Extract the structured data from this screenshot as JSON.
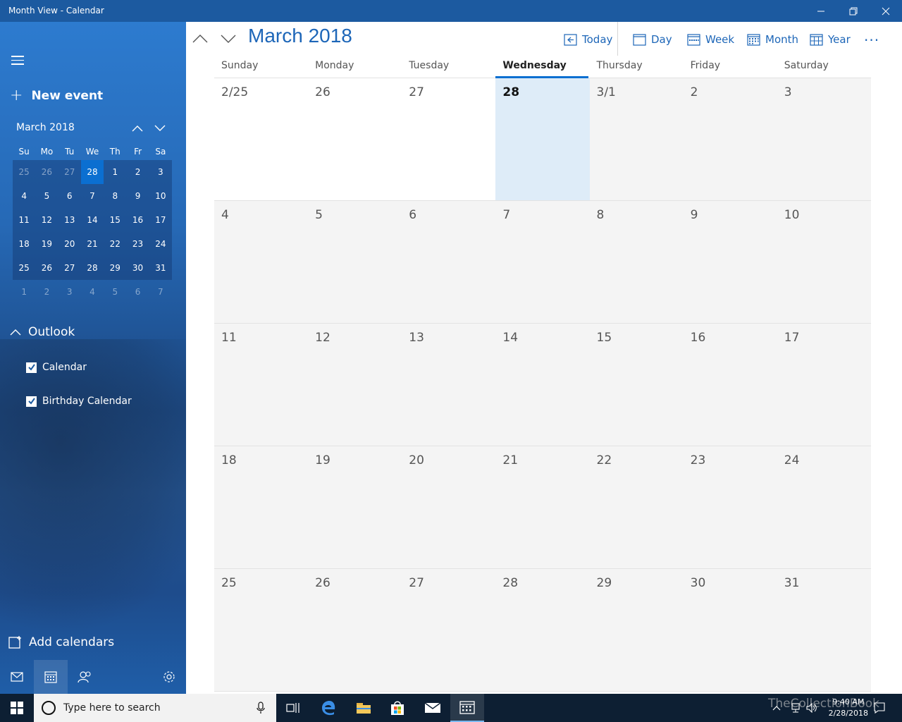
{
  "window": {
    "title": "Month View - Calendar"
  },
  "sidebar": {
    "new_event_label": "New event",
    "mini_calendar": {
      "title": "March 2018",
      "weekday_headers": [
        "Su",
        "Mo",
        "Tu",
        "We",
        "Th",
        "Fr",
        "Sa"
      ],
      "weeks": [
        [
          "25",
          "26",
          "27",
          "28",
          "1",
          "2",
          "3"
        ],
        [
          "4",
          "5",
          "6",
          "7",
          "8",
          "9",
          "10"
        ],
        [
          "11",
          "12",
          "13",
          "14",
          "15",
          "16",
          "17"
        ],
        [
          "18",
          "19",
          "20",
          "21",
          "22",
          "23",
          "24"
        ],
        [
          "25",
          "26",
          "27",
          "28",
          "29",
          "30",
          "31"
        ],
        [
          "1",
          "2",
          "3",
          "4",
          "5",
          "6",
          "7"
        ]
      ],
      "selected_day": "28"
    },
    "account_label": "Outlook",
    "calendars": [
      {
        "label": "Calendar",
        "checked": true
      },
      {
        "label": "Birthday Calendar",
        "checked": true
      }
    ],
    "add_calendars_label": "Add calendars"
  },
  "header": {
    "month_title": "March 2018",
    "toolbar": {
      "today_label": "Today",
      "day_label": "Day",
      "week_label": "Week",
      "month_label": "Month",
      "year_label": "Year",
      "more_label": "···"
    }
  },
  "month_grid": {
    "weekday_headers": [
      "Sunday",
      "Monday",
      "Tuesday",
      "Wednesday",
      "Thursday",
      "Friday",
      "Saturday"
    ],
    "active_weekday": "Wednesday",
    "weeks": [
      [
        "2/25",
        "26",
        "27",
        "28",
        "3/1",
        "2",
        "3"
      ],
      [
        "4",
        "5",
        "6",
        "7",
        "8",
        "9",
        "10"
      ],
      [
        "11",
        "12",
        "13",
        "14",
        "15",
        "16",
        "17"
      ],
      [
        "18",
        "19",
        "20",
        "21",
        "22",
        "23",
        "24"
      ],
      [
        "25",
        "26",
        "27",
        "28",
        "29",
        "30",
        "31"
      ]
    ],
    "today": "28"
  },
  "taskbar": {
    "search_placeholder": "Type here to search",
    "time": "9:40 AM",
    "date": "2/28/2018",
    "watermark": "TheCollectionBook"
  },
  "colors": {
    "titlebar": "#1c5aa0",
    "accent": "#1d66b8",
    "today_highlight": "#deecf8",
    "selected_blue": "#0b6fd1",
    "taskbar": "#0d1f33"
  }
}
